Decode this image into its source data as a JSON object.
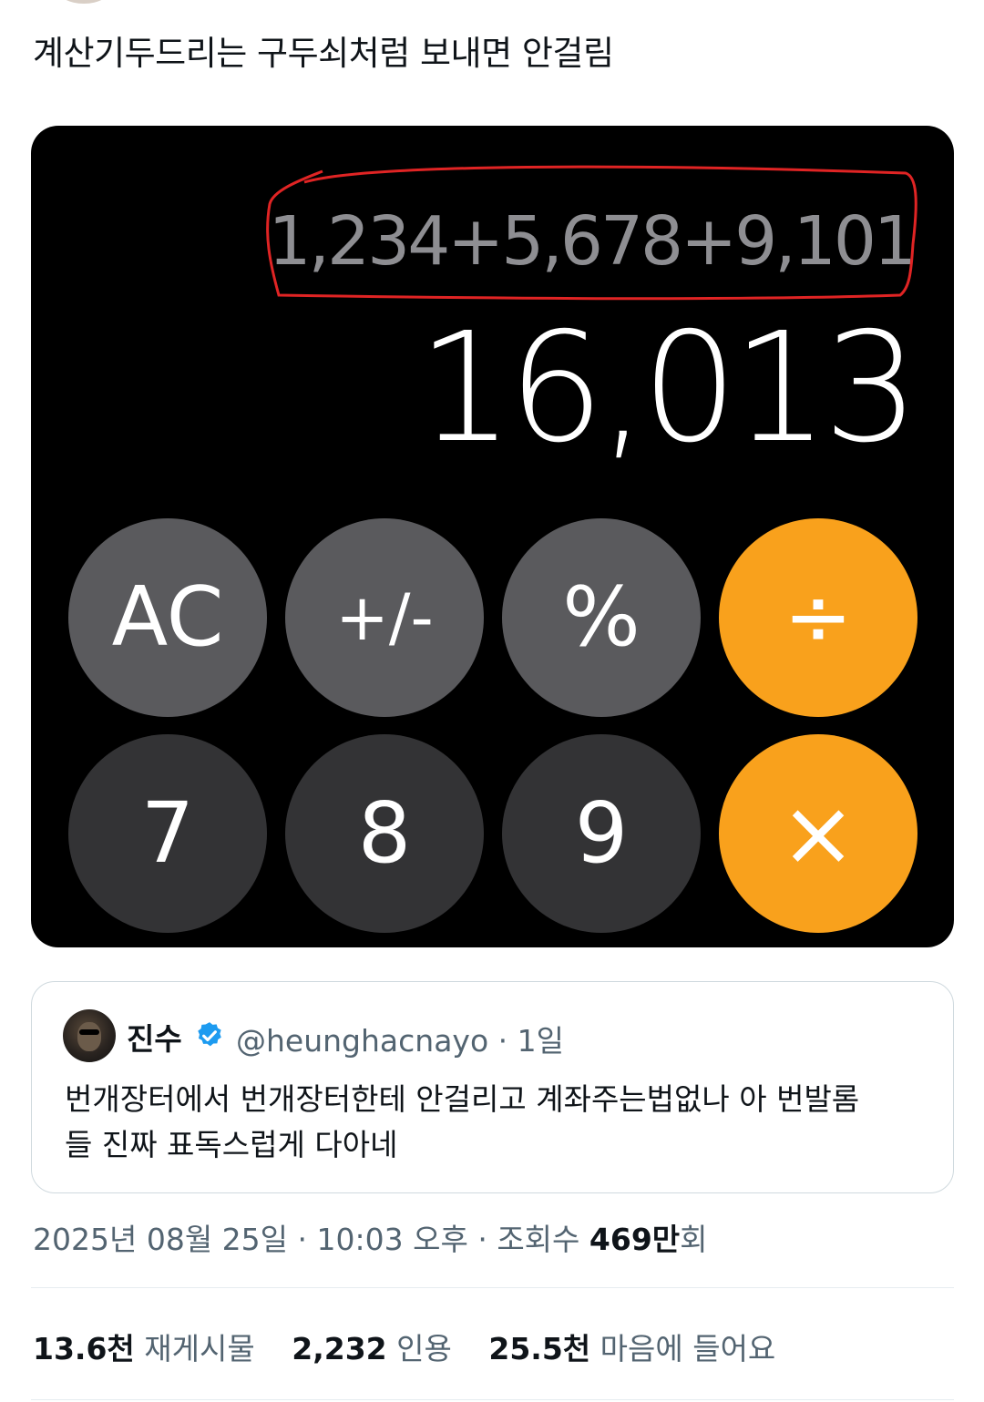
{
  "tweet": {
    "text": "계산기두드리는 구두쇠처럼 보내면 안걸림"
  },
  "calculator": {
    "expression": "1,234+5,678+9,101",
    "result": "16,013",
    "keys_row1": [
      "AC",
      "+/-",
      "%",
      "÷"
    ],
    "keys_row2": [
      "7",
      "8",
      "9",
      "×"
    ],
    "annotation_color": "#e02424",
    "orange": "#f9a11c"
  },
  "quoted_tweet": {
    "name": "진수",
    "handle": "@heunghacnayo",
    "time": "1일",
    "text": "번개장터에서 번개장터한테 안걸리고 계좌주는법없나 아 번발롬들 진짜 표독스럽게 다아네"
  },
  "meta": {
    "date": "2025년 08월 25일",
    "time": "10:03 오후",
    "views_label": "조회수",
    "views_value": "469만",
    "views_unit": "회"
  },
  "stats": {
    "retweets_value": "13.6천",
    "retweets_label": "재게시물",
    "quotes_value": "2,232",
    "quotes_label": "인용",
    "likes_value": "25.5천",
    "likes_label": "마음에 들어요"
  }
}
